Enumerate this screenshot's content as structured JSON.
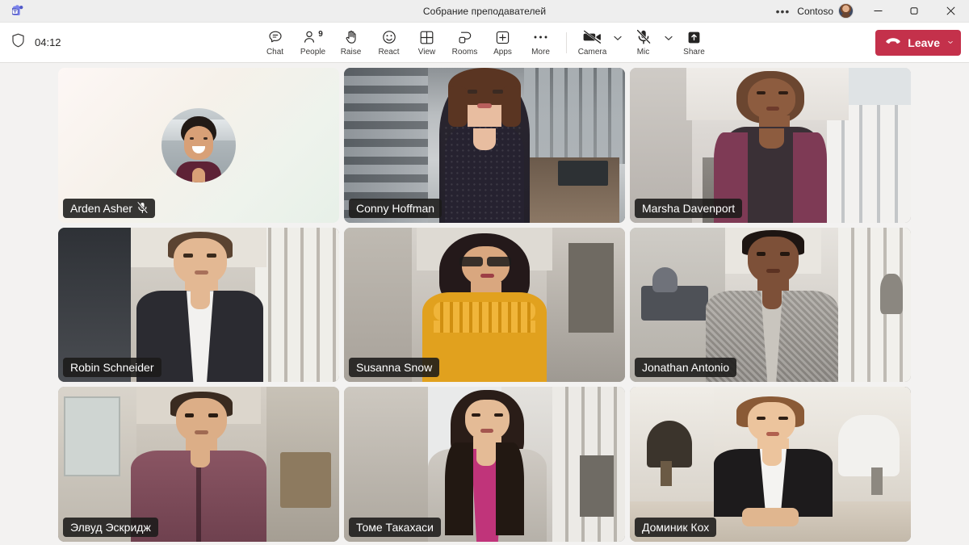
{
  "titlebar": {
    "app_icon": "teams-logo-icon",
    "title": "Собрание преподавателей",
    "overflow_label": "•••",
    "org": "Contoso",
    "avatar": "user-avatar",
    "minimize": "minimize-icon",
    "maximize": "restore-icon",
    "close": "close-icon"
  },
  "toolbar": {
    "shield_icon": "shield-icon",
    "timer": "04:12",
    "buttons": [
      {
        "label": "Chat",
        "icon": "chat-icon",
        "badge": ""
      },
      {
        "label": "People",
        "icon": "people-icon",
        "badge": "9"
      },
      {
        "label": "Raise",
        "icon": "raise-hand-icon",
        "badge": ""
      },
      {
        "label": "React",
        "icon": "react-smiley-icon",
        "badge": ""
      },
      {
        "label": "View",
        "icon": "view-grid-icon",
        "badge": ""
      },
      {
        "label": "Rooms",
        "icon": "breakout-rooms-icon",
        "badge": ""
      },
      {
        "label": "Apps",
        "icon": "apps-plus-icon",
        "badge": ""
      },
      {
        "label": "More",
        "icon": "more-ellipsis-icon",
        "badge": ""
      }
    ],
    "devices": [
      {
        "label": "Camera",
        "icon": "camera-off-icon",
        "state": "off"
      },
      {
        "label": "Mic",
        "icon": "mic-off-icon",
        "state": "muted"
      },
      {
        "label": "Share",
        "icon": "share-screen-icon",
        "state": "idle"
      }
    ],
    "leave": {
      "label": "Leave",
      "icon": "hangup-icon",
      "chevron": "chevron-down-icon",
      "color": "#c4314b"
    }
  },
  "stage": {
    "tiles": [
      {
        "name": "Arden Asher",
        "video": false,
        "muted": true,
        "avatar": true
      },
      {
        "name": "Conny Hoffman",
        "video": true,
        "muted": false,
        "avatar": false
      },
      {
        "name": "Marsha Davenport",
        "video": true,
        "muted": false,
        "avatar": false
      },
      {
        "name": "Robin Schneider",
        "video": true,
        "muted": false,
        "avatar": false
      },
      {
        "name": "Susanna Snow",
        "video": true,
        "muted": false,
        "avatar": false
      },
      {
        "name": "Jonathan Antonio",
        "video": true,
        "muted": false,
        "avatar": false
      },
      {
        "name": "Элвуд Эскридж",
        "video": true,
        "muted": false,
        "avatar": false
      },
      {
        "name": "Томе Такахаси",
        "video": true,
        "muted": false,
        "avatar": false
      },
      {
        "name": "Доминик Кох",
        "video": true,
        "muted": false,
        "avatar": false
      }
    ]
  },
  "colors": {
    "titlebar_bg": "#eeeeee",
    "toolbar_bg": "#ffffff",
    "stage_bg": "#f3f2f1",
    "leave_red": "#c4314b",
    "label_bg": "rgba(27,26,25,.88)",
    "text": "#252423"
  }
}
